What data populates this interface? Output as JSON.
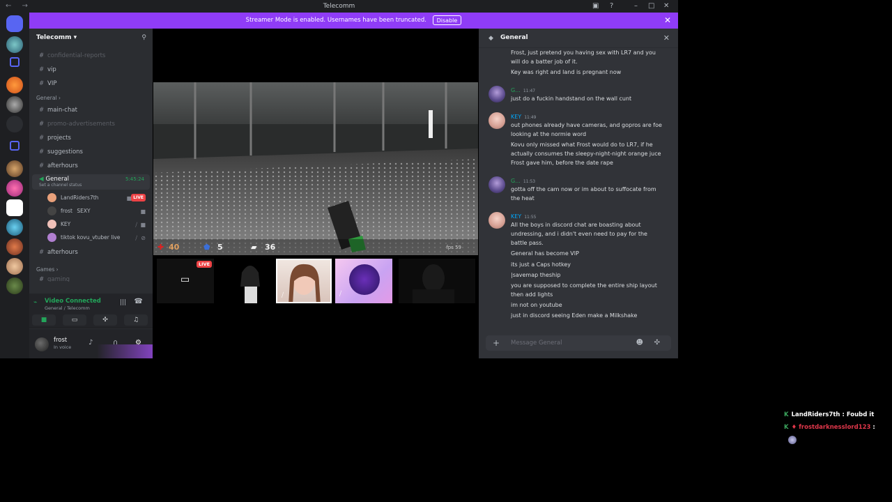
{
  "window": {
    "title": "Telecomm"
  },
  "banner": {
    "text": "Streamer Mode is enabled. Usernames have been truncated.",
    "button": "Disable"
  },
  "server": {
    "name": "Telecomm"
  },
  "channels_top": [
    {
      "name": "confidential-reports",
      "state": "muted"
    },
    {
      "name": "vip",
      "state": "bright"
    },
    {
      "name": "VIP",
      "state": "bright"
    }
  ],
  "category_general": "General",
  "channels_general": [
    {
      "name": "main-chat",
      "state": "bright"
    },
    {
      "name": "promo-advertisements",
      "state": "muted"
    },
    {
      "name": "projects",
      "state": "bright"
    },
    {
      "name": "suggestions",
      "state": "bright"
    },
    {
      "name": "afterhours",
      "state": "bright"
    }
  ],
  "voice_channel": {
    "name": "General",
    "timer": "5:45:24",
    "sub": "Set a channel status"
  },
  "voice_users": [
    {
      "name": "LandRiders7th",
      "live": "LIVE",
      "color": "#e8a07a"
    },
    {
      "name": "frost",
      "tag": "SEXY",
      "color": "#444"
    },
    {
      "name": "KEY",
      "color": "#f0c0b8"
    },
    {
      "name": "tiktok kovu_vtuber live",
      "color": "#b07fd0"
    }
  ],
  "channel_after": "afterhours",
  "category_games": "Games",
  "channel_games_partial": "gaming",
  "voice_panel": {
    "status": "Video Connected",
    "location": "General / Telecomm"
  },
  "user": {
    "name": "frost",
    "status": "In voice"
  },
  "hud": {
    "health": "40",
    "armor": "5",
    "ammo": "36",
    "fps": "fps 59"
  },
  "tiles": {
    "live": "LIVE"
  },
  "chat": {
    "channel": "General",
    "placeholder": "Message General",
    "messages": [
      {
        "lines": [
          "Frost, just pretend you having sex with LR7 and you will do a batter job of it.",
          "Key was right and land is pregnant now"
        ]
      },
      {
        "author": "G...",
        "time": "11:47",
        "color": "#23a55a",
        "lines": [
          "just do a fuckin handstand on the wall cunt"
        ]
      },
      {
        "author": "KEY",
        "time": "11:49",
        "color": "#00a8fc",
        "lines": [
          "out phones already have cameras, and gopros are foe looking at the normie word",
          "Kovu only missed what Frost would do to LR7, if he actually consumes the sleepy-night-night orange juce Frost gave him, before the date rape"
        ]
      },
      {
        "author": "G...",
        "time": "11:53",
        "color": "#23a55a",
        "lines": [
          "gotta off the cam now or im about to suffocate from the heat"
        ]
      },
      {
        "author": "KEY",
        "time": "11:55",
        "color": "#00a8fc",
        "lines": [
          "All the boys in discord chat are boasting about undressing, and i didn't even need to pay for the battle pass.",
          "General has become VIP",
          "its just a Caps hotkey",
          "|savemap theship",
          "you are supposed to complete the entire ship layout then add lights",
          "im not on youtube",
          "just in discord seeing Eden make a Milkshake"
        ]
      }
    ]
  },
  "overlay": [
    {
      "user": "LandRiders7th",
      "text": "Foubd it"
    },
    {
      "user": "frostdarknesslord123",
      "text": ""
    }
  ]
}
